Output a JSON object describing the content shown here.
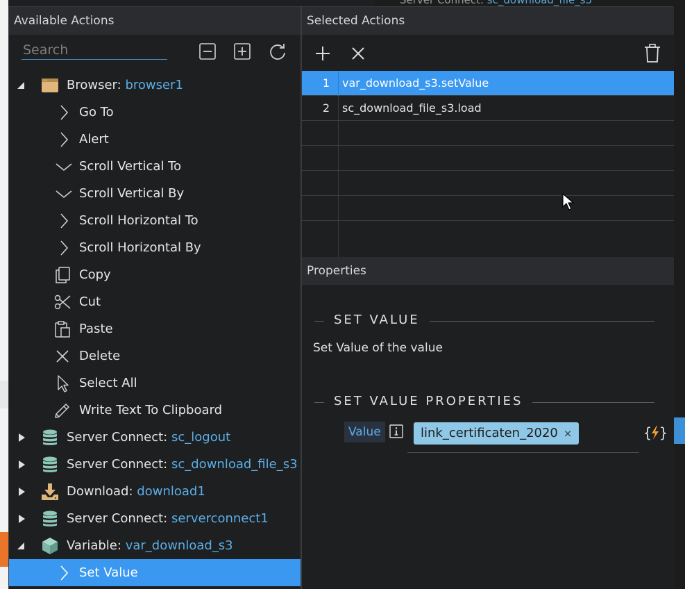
{
  "background": {
    "top_peek": {
      "label": "Server Connect:",
      "value": "sc_download_file_s3"
    }
  },
  "available_actions": {
    "title": "Available Actions",
    "search_placeholder": "Search",
    "toolbar": [
      "collapse-all-icon",
      "expand-all-icon",
      "refresh-icon"
    ],
    "tree": [
      {
        "label": "Browser:",
        "value": "browser1",
        "icon": "browser-icon",
        "expanded": true
      },
      {
        "label": "Go To",
        "icon": "chevron-right-icon"
      },
      {
        "label": "Alert",
        "icon": "chevron-right-icon"
      },
      {
        "label": "Scroll Vertical To",
        "icon": "chevron-down-icon"
      },
      {
        "label": "Scroll Vertical By",
        "icon": "chevron-down-icon"
      },
      {
        "label": "Scroll Horizontal To",
        "icon": "chevron-right-icon"
      },
      {
        "label": "Scroll Horizontal By",
        "icon": "chevron-right-icon"
      },
      {
        "label": "Copy",
        "icon": "copy-icon"
      },
      {
        "label": "Cut",
        "icon": "scissors-icon"
      },
      {
        "label": "Paste",
        "icon": "paste-icon"
      },
      {
        "label": "Delete",
        "icon": "x-icon"
      },
      {
        "label": "Select All",
        "icon": "pointer-icon"
      },
      {
        "label": "Write Text To Clipboard",
        "icon": "pencil-icon"
      },
      {
        "label": "Server Connect:",
        "value": "sc_logout",
        "icon": "database-icon",
        "expanded": false
      },
      {
        "label": "Server Connect:",
        "value": "sc_download_file_s3",
        "icon": "database-icon",
        "expanded": false
      },
      {
        "label": "Download:",
        "value": "download1",
        "icon": "download-icon",
        "expanded": false
      },
      {
        "label": "Server Connect:",
        "value": "serverconnect1",
        "icon": "database-icon",
        "expanded": false
      },
      {
        "label": "Variable:",
        "value": "var_download_s3",
        "icon": "cube-icon",
        "expanded": true
      },
      {
        "label": "Set Value",
        "icon": "chevron-right-icon",
        "selected": true
      }
    ]
  },
  "selected_actions": {
    "title": "Selected Actions",
    "rows": [
      {
        "num": "1",
        "name": "var_download_s3.setValue"
      },
      {
        "num": "2",
        "name": "sc_download_file_s3.load"
      }
    ]
  },
  "properties": {
    "title": "Properties",
    "section1": "SET VALUE",
    "description": "Set Value of the value",
    "section2": "SET VALUE PROPERTIES",
    "value_label": "Value",
    "chip_value": "link_certificaten_2020",
    "chip_remove": "×",
    "dynamic_button": "{⚡}"
  },
  "colors": {
    "accent": "#3a98f1",
    "link": "#5aaee6",
    "chip": "#8fc7e6",
    "bolt": "#f0a030"
  }
}
